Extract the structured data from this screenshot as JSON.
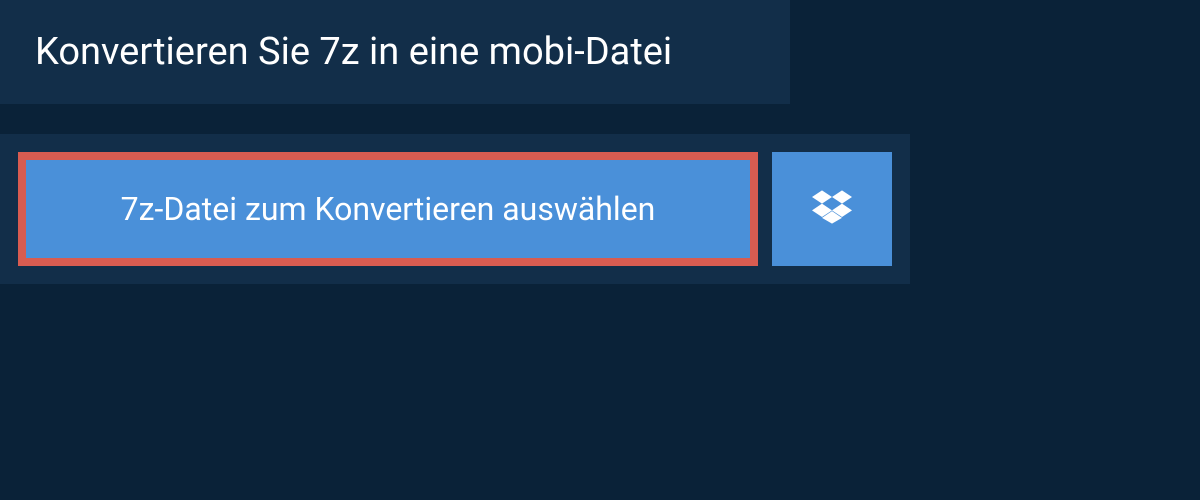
{
  "header": {
    "title": "Konvertieren Sie 7z in eine mobi-Datei"
  },
  "upload": {
    "select_button_label": "7z-Datei zum Konvertieren auswählen",
    "dropbox_icon": "dropbox"
  },
  "colors": {
    "background": "#0a2238",
    "panel": "#122e49",
    "button": "#4a90d9",
    "highlight_border": "#d85c51",
    "text": "#ffffff"
  }
}
